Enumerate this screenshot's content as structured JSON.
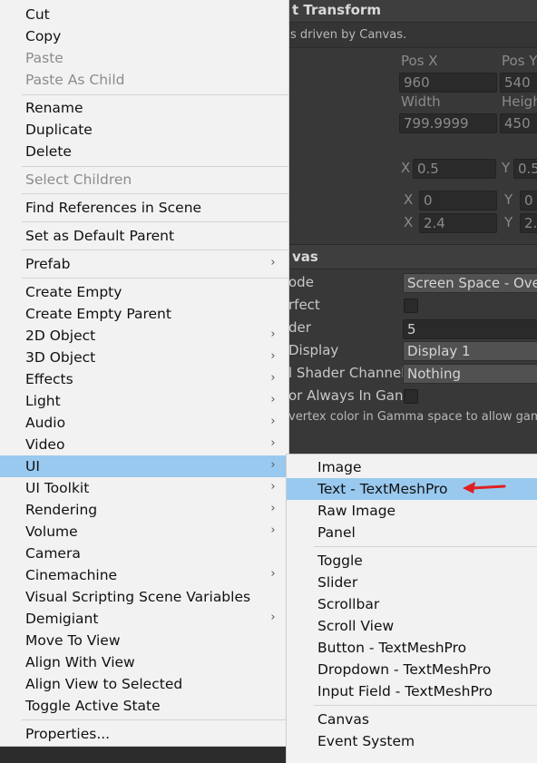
{
  "inspector": {
    "rect_transform_title": "t Transform",
    "driven_note": "s driven by Canvas.",
    "pos_x_label": "Pos X",
    "pos_y_label": "Pos Y",
    "pos_x_value": "960",
    "pos_y_value": "540",
    "width_label": "Width",
    "height_label": "Heigh",
    "width_value": "799.9999",
    "height_value": "450",
    "anchor_x_label": "X",
    "anchor_x_value": "0.5",
    "anchor_y_label": "Y",
    "anchor_y_value": "0.5",
    "rot_x_label": "X",
    "rot_x_value": "0",
    "rot_y_label": "Y",
    "rot_y_value": "0",
    "scale_x_label": "X",
    "scale_x_value": "2.4",
    "scale_y_label": "Y",
    "scale_y_value": "2.",
    "canvas_title": "vas",
    "render_mode_label": "ode",
    "render_mode_value": "Screen Space - Ove",
    "pixel_perfect_label": "rfect",
    "sort_order_label": "der",
    "sort_order_value": "5",
    "target_display_label": "Display",
    "target_display_value": "Display 1",
    "shader_channels_label": "l Shader Channels",
    "shader_channels_value": "Nothing",
    "vertex_color_label": "or Always In Gan",
    "gamma_note": "vertex color in Gamma space to allow gamm"
  },
  "main_menu": {
    "cut": "Cut",
    "copy": "Copy",
    "paste": "Paste",
    "paste_as_child": "Paste As Child",
    "rename": "Rename",
    "duplicate": "Duplicate",
    "delete": "Delete",
    "select_children": "Select Children",
    "find_references": "Find References in Scene",
    "set_default_parent": "Set as Default Parent",
    "prefab": "Prefab",
    "create_empty": "Create Empty",
    "create_empty_parent": "Create Empty Parent",
    "object_2d": "2D Object",
    "object_3d": "3D Object",
    "effects": "Effects",
    "light": "Light",
    "audio": "Audio",
    "video": "Video",
    "ui": "UI",
    "ui_toolkit": "UI Toolkit",
    "rendering": "Rendering",
    "volume": "Volume",
    "camera": "Camera",
    "cinemachine": "Cinemachine",
    "visual_scripting": "Visual Scripting Scene Variables",
    "demigiant": "Demigiant",
    "move_to_view": "Move To View",
    "align_with_view": "Align With View",
    "align_view_to_selected": "Align View to Selected",
    "toggle_active_state": "Toggle Active State",
    "properties": "Properties..."
  },
  "ui_submenu": {
    "image": "Image",
    "text_tmp": "Text - TextMeshPro",
    "raw_image": "Raw Image",
    "panel": "Panel",
    "toggle": "Toggle",
    "slider": "Slider",
    "scrollbar": "Scrollbar",
    "scroll_view": "Scroll View",
    "button_tmp": "Button - TextMeshPro",
    "dropdown_tmp": "Dropdown - TextMeshPro",
    "input_field_tmp": "Input Field - TextMeshPro",
    "canvas": "Canvas",
    "event_system": "Event System"
  },
  "icons": {
    "submenu_arrow": "chevron-right-icon",
    "annotation": "red-arrow-icon"
  },
  "colors": {
    "menu_bg": "#f2f2f2",
    "highlight": "#99c9ef",
    "disabled_text": "#8c8c8c",
    "inspector_bg": "#383838",
    "annotation_red": "#e02020"
  }
}
